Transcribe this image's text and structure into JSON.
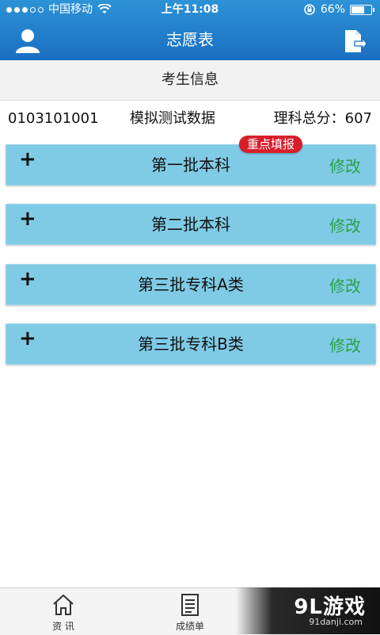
{
  "status": {
    "carrier": "中国移动",
    "time": "上午11:08",
    "battery_text": "66%",
    "battery_level": 0.66
  },
  "nav": {
    "title": "志愿表"
  },
  "section": {
    "title": "考生信息"
  },
  "student": {
    "id": "0103101001",
    "name": "模拟测试数据",
    "score_text": "理科总分：607"
  },
  "badge": {
    "text": "重点填报"
  },
  "batches": [
    {
      "label": "第一批本科",
      "edit": "修改"
    },
    {
      "label": "第二批本科",
      "edit": "修改"
    },
    {
      "label": "第三批专科A类",
      "edit": "修改"
    },
    {
      "label": "第三批专科B类",
      "edit": "修改"
    }
  ],
  "tabs": [
    {
      "label": "资 讯",
      "icon": "home-icon"
    },
    {
      "label": "成绩单",
      "icon": "document-list-icon"
    }
  ],
  "watermark": {
    "logo": "9L游戏",
    "site": "91danji.com"
  },
  "colors": {
    "header_blue": "#1a6fc1",
    "batch_bg": "#7fcbe6",
    "edit_green": "#2aa248",
    "badge_red": "#d81e2b"
  }
}
